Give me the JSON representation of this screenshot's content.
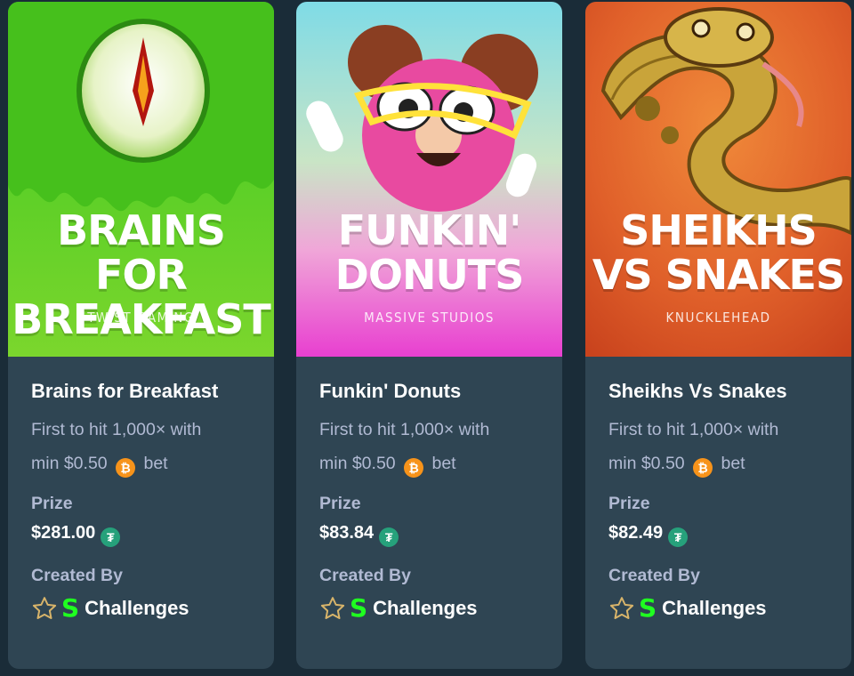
{
  "currency_icons": {
    "bet": "bitcoin-icon",
    "prize": "tether-icon"
  },
  "colors": {
    "page_bg": "#1a2c38",
    "card_bg": "#2f4553",
    "muted_text": "#b1bad3",
    "btc": "#f7931a",
    "usdt": "#26a17b",
    "stake_green": "#1fff20"
  },
  "cards": [
    {
      "art_title": "BRAINS FOR BREAKFAST",
      "art_studio": "TWIST GAMING",
      "name": "Brains for Breakfast",
      "desc_line1": "First to hit 1,000× with",
      "desc_min": "min $0.50",
      "desc_bet": "bet",
      "prize_label": "Prize",
      "prize_value": "$281.00",
      "created_label": "Created By",
      "creator_mark": "S",
      "creator_name": "Challenges"
    },
    {
      "art_title": "FUNKIN' DONUTS",
      "art_studio": "MASSIVE STUDIOS",
      "name": "Funkin' Donuts",
      "desc_line1": "First to hit 1,000× with",
      "desc_min": "min $0.50",
      "desc_bet": "bet",
      "prize_label": "Prize",
      "prize_value": "$83.84",
      "created_label": "Created By",
      "creator_mark": "S",
      "creator_name": "Challenges"
    },
    {
      "art_title": "SHEIKHS VS SNAKES",
      "art_studio": "KNUCKLEHEAD",
      "name": "Sheikhs Vs Snakes",
      "desc_line1": "First to hit 1,000× with",
      "desc_min": "min $0.50",
      "desc_bet": "bet",
      "prize_label": "Prize",
      "prize_value": "$82.49",
      "created_label": "Created By",
      "creator_mark": "S",
      "creator_name": "Challenges"
    }
  ]
}
